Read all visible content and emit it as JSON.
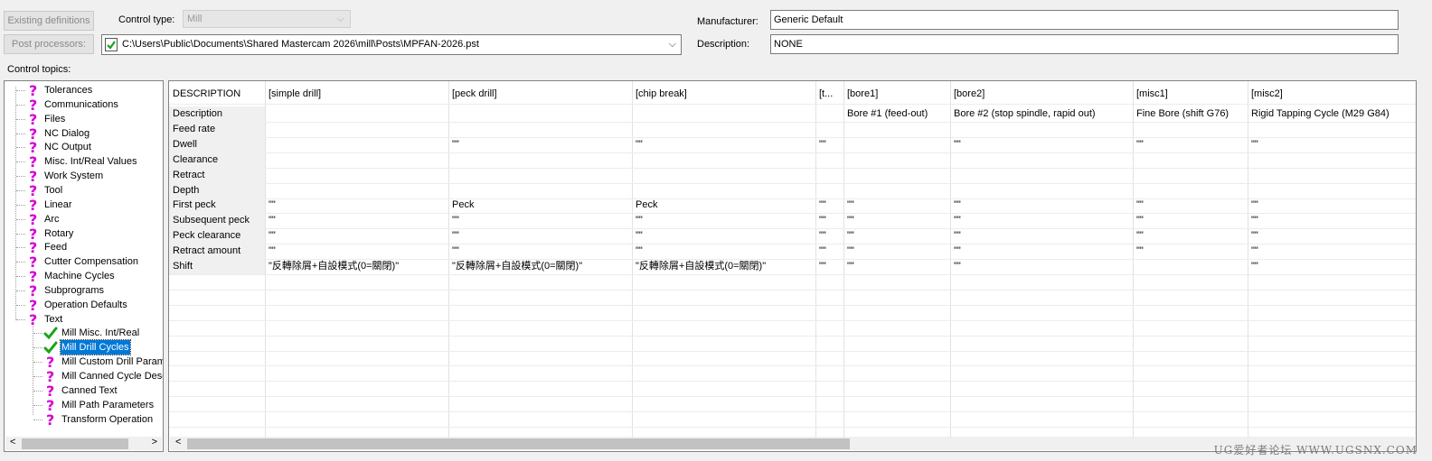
{
  "top": {
    "existing_definitions_label": "Existing definitions",
    "post_processors_label": "Post processors:",
    "control_type_label": "Control type:",
    "control_type_value": "Mill",
    "post_path": "C:\\Users\\Public\\Documents\\Shared Mastercam 2026\\mill\\Posts\\MPFAN-2026.pst",
    "manufacturer_label": "Manufacturer:",
    "manufacturer_value": "Generic Default",
    "description_label": "Description:",
    "description_value": "NONE",
    "control_topics_label": "Control topics:"
  },
  "tree": {
    "root_items": [
      "Tolerances",
      "Communications",
      "Files",
      "NC Dialog",
      "NC Output",
      "Misc. Int/Real Values",
      "Work System",
      "Tool",
      "Linear",
      "Arc",
      "Rotary",
      "Feed",
      "Cutter Compensation",
      "Machine Cycles",
      "Subprograms",
      "Operation Defaults",
      "Text"
    ],
    "child_items": [
      {
        "label": "Mill Misc. Int/Real",
        "icon": "check"
      },
      {
        "label": "Mill Drill Cycles",
        "icon": "check",
        "selected": true
      },
      {
        "label": "Mill Custom Drill Paramet",
        "icon": "question"
      },
      {
        "label": "Mill Canned Cycle Descr",
        "icon": "question"
      },
      {
        "label": "Canned Text",
        "icon": "question"
      },
      {
        "label": "Mill Path Parameters",
        "icon": "question"
      },
      {
        "label": "Transform Operation",
        "icon": "question"
      }
    ]
  },
  "grid": {
    "headers": [
      "DESCRIPTION",
      "[simple drill]",
      "[peck drill]",
      "[chip break]",
      "[t...",
      "[bore1]",
      "[bore2]",
      "[misc1]",
      "[misc2]"
    ],
    "rows": [
      [
        "Description",
        "",
        "",
        "",
        "",
        "Bore #1 (feed-out)",
        "Bore #2 (stop spindle, rapid out)",
        "Fine Bore (shift G76)",
        "Rigid Tapping Cycle (M29 G84)"
      ],
      [
        "Feed rate",
        "",
        "",
        "",
        "",
        "",
        "",
        "",
        ""
      ],
      [
        "Dwell",
        "",
        "\"\"",
        "\"\"",
        "\"\"",
        "",
        "\"\"",
        "\"\"",
        "\"\""
      ],
      [
        "Clearance",
        "",
        "",
        "",
        "",
        "",
        "",
        "",
        ""
      ],
      [
        "Retract",
        "",
        "",
        "",
        "",
        "",
        "",
        "",
        ""
      ],
      [
        "Depth",
        "",
        "",
        "",
        "",
        "",
        "",
        "",
        ""
      ],
      [
        "First peck",
        "\"\"",
        "Peck",
        "Peck",
        "\"\"",
        "\"\"",
        "\"\"",
        "\"\"",
        "\"\""
      ],
      [
        "Subsequent peck",
        "\"\"",
        "\"\"",
        "\"\"",
        "\"\"",
        "\"\"",
        "\"\"",
        "\"\"",
        "\"\""
      ],
      [
        "Peck clearance",
        "\"\"",
        "\"\"",
        "\"\"",
        "\"\"",
        "\"\"",
        "\"\"",
        "\"\"",
        "\"\""
      ],
      [
        "Retract amount",
        "\"\"",
        "\"\"",
        "\"\"",
        "\"\"",
        "\"\"",
        "\"\"",
        "\"\"",
        "\"\""
      ],
      [
        "Shift",
        "\"反轉除屑+自設模式(0=關閉)\"",
        "\"反轉除屑+自設模式(0=關閉)\"",
        "\"反轉除屑+自設模式(0=關閉)\"",
        "\"\"",
        "\"\"",
        "\"\"",
        "",
        "\"\""
      ]
    ]
  },
  "watermark": "UG爱好者论坛 WWW.UGSNX.COM",
  "colors": {
    "selection": "#0078d7",
    "question_icon": "#d400d4",
    "check_icon": "#1aa31a"
  }
}
